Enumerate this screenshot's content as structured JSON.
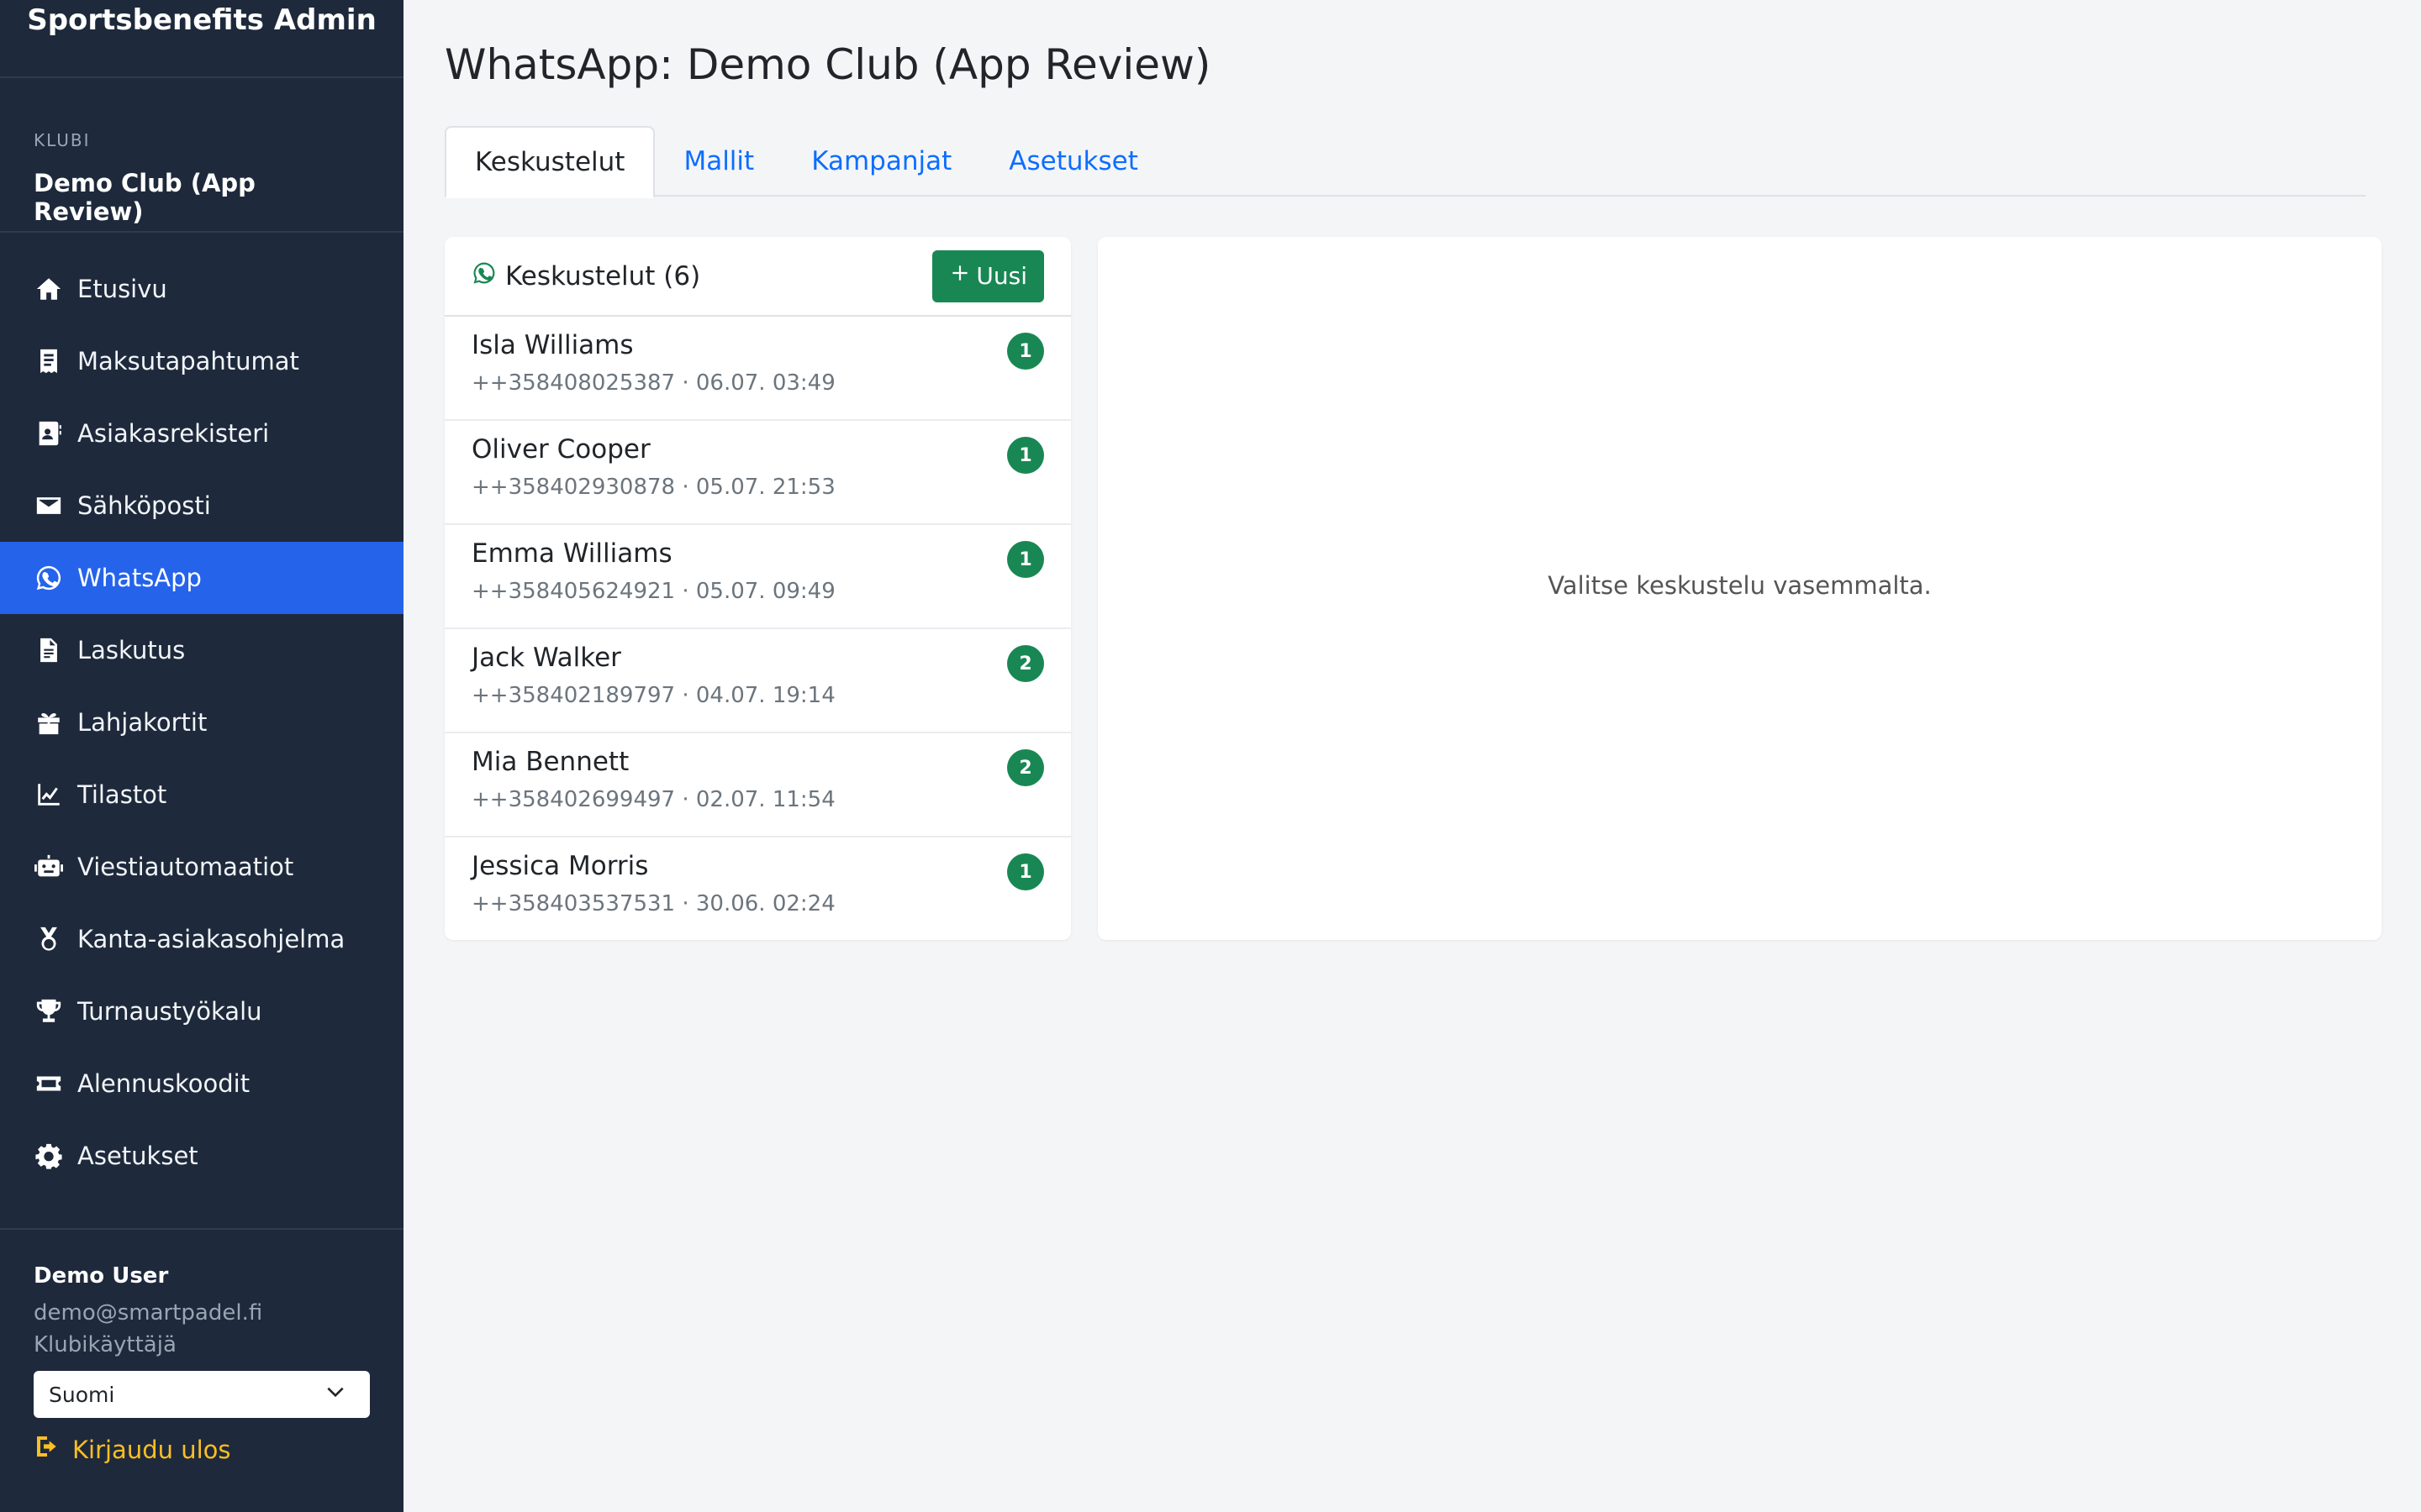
{
  "brand": "Sportsbenefits Admin",
  "club": {
    "label": "KLUBI",
    "name": "Demo Club (App Review)"
  },
  "nav": [
    {
      "label": "Etusivu",
      "icon": "home-icon",
      "active": false
    },
    {
      "label": "Maksutapahtumat",
      "icon": "receipt-icon",
      "active": false
    },
    {
      "label": "Asiakasrekisteri",
      "icon": "contact-card-icon",
      "active": false
    },
    {
      "label": "Sähköposti",
      "icon": "envelope-icon",
      "active": false
    },
    {
      "label": "WhatsApp",
      "icon": "whatsapp-icon",
      "active": true
    },
    {
      "label": "Laskutus",
      "icon": "document-icon",
      "active": false
    },
    {
      "label": "Lahjakortit",
      "icon": "gift-icon",
      "active": false
    },
    {
      "label": "Tilastot",
      "icon": "chart-line-icon",
      "active": false
    },
    {
      "label": "Viestiautomaatiot",
      "icon": "robot-icon",
      "active": false
    },
    {
      "label": "Kanta-asiakasohjelma",
      "icon": "medal-icon",
      "active": false
    },
    {
      "label": "Turnaustyökalu",
      "icon": "trophy-icon",
      "active": false
    },
    {
      "label": "Alennuskoodit",
      "icon": "ticket-icon",
      "active": false
    },
    {
      "label": "Asetukset",
      "icon": "gear-icon",
      "active": false
    }
  ],
  "user": {
    "name": "Demo User",
    "email": "demo@smartpadel.fi",
    "role": "Klubikäyttäjä",
    "language": "Suomi",
    "logout_label": "Kirjaudu ulos"
  },
  "page": {
    "title": "WhatsApp: Demo Club (App Review)",
    "tabs": [
      {
        "label": "Keskustelut",
        "active": true
      },
      {
        "label": "Mallit",
        "active": false
      },
      {
        "label": "Kampanjat",
        "active": false
      },
      {
        "label": "Asetukset",
        "active": false
      }
    ]
  },
  "conversations": {
    "title": "Keskustelut (6)",
    "new_label": "Uusi",
    "items": [
      {
        "name": "Isla Williams",
        "meta": "++358408025387 · 06.07. 03:49",
        "unread": "1"
      },
      {
        "name": "Oliver Cooper",
        "meta": "++358402930878 · 05.07. 21:53",
        "unread": "1"
      },
      {
        "name": "Emma Williams",
        "meta": "++358405624921 · 05.07. 09:49",
        "unread": "1"
      },
      {
        "name": "Jack Walker",
        "meta": "++358402189797 · 04.07. 19:14",
        "unread": "2"
      },
      {
        "name": "Mia Bennett",
        "meta": "++358402699497 · 02.07. 11:54",
        "unread": "2"
      },
      {
        "name": "Jessica Morris",
        "meta": "++358403537531 · 30.06. 02:24",
        "unread": "1"
      }
    ]
  },
  "detail": {
    "empty_text": "Valitse keskustelu vasemmalta."
  },
  "colors": {
    "sidebar": "#1e293b",
    "active_nav": "#2563eb",
    "accent_green": "#198754",
    "link_blue": "#0d6efd",
    "logout_yellow": "#fbbf24"
  }
}
